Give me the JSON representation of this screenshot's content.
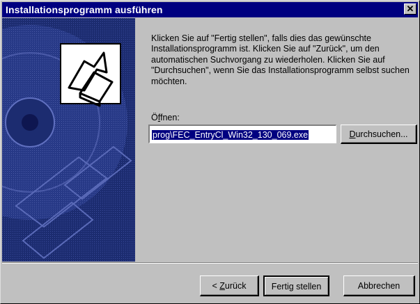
{
  "window": {
    "title": "Installationsprogramm ausführen",
    "close_glyph": "✕"
  },
  "content": {
    "message": "Klicken Sie auf \"Fertig stellen\", falls dies das gewünschte Installationsprogramm ist. Klicken Sie auf \"Zurück\", um den automatischen Suchvorgang zu wiederholen. Klicken Sie auf \"Durchsuchen\", wenn Sie das Installationsprogramm selbst suchen möchten.",
    "open_label_prefix": "Ö",
    "open_label_accel": "f",
    "open_label_suffix": "fnen:",
    "open_value": "prog\\FEC_EntryCl_Win32_130_069.exe",
    "browse_accel": "D",
    "browse_rest": "urchsuchen..."
  },
  "footer": {
    "back_prefix": "< ",
    "back_accel": "Z",
    "back_rest": "urück",
    "finish_label": "Fertig stellen",
    "cancel_label": "Abbrechen"
  },
  "colors": {
    "titlebar": "#000080",
    "face": "#c0c0c0",
    "banner": "#1a2a6c",
    "selection": "#000080"
  },
  "icons": {
    "banner": "cd-setup-banner-icon",
    "program": "setup-program-icon"
  }
}
